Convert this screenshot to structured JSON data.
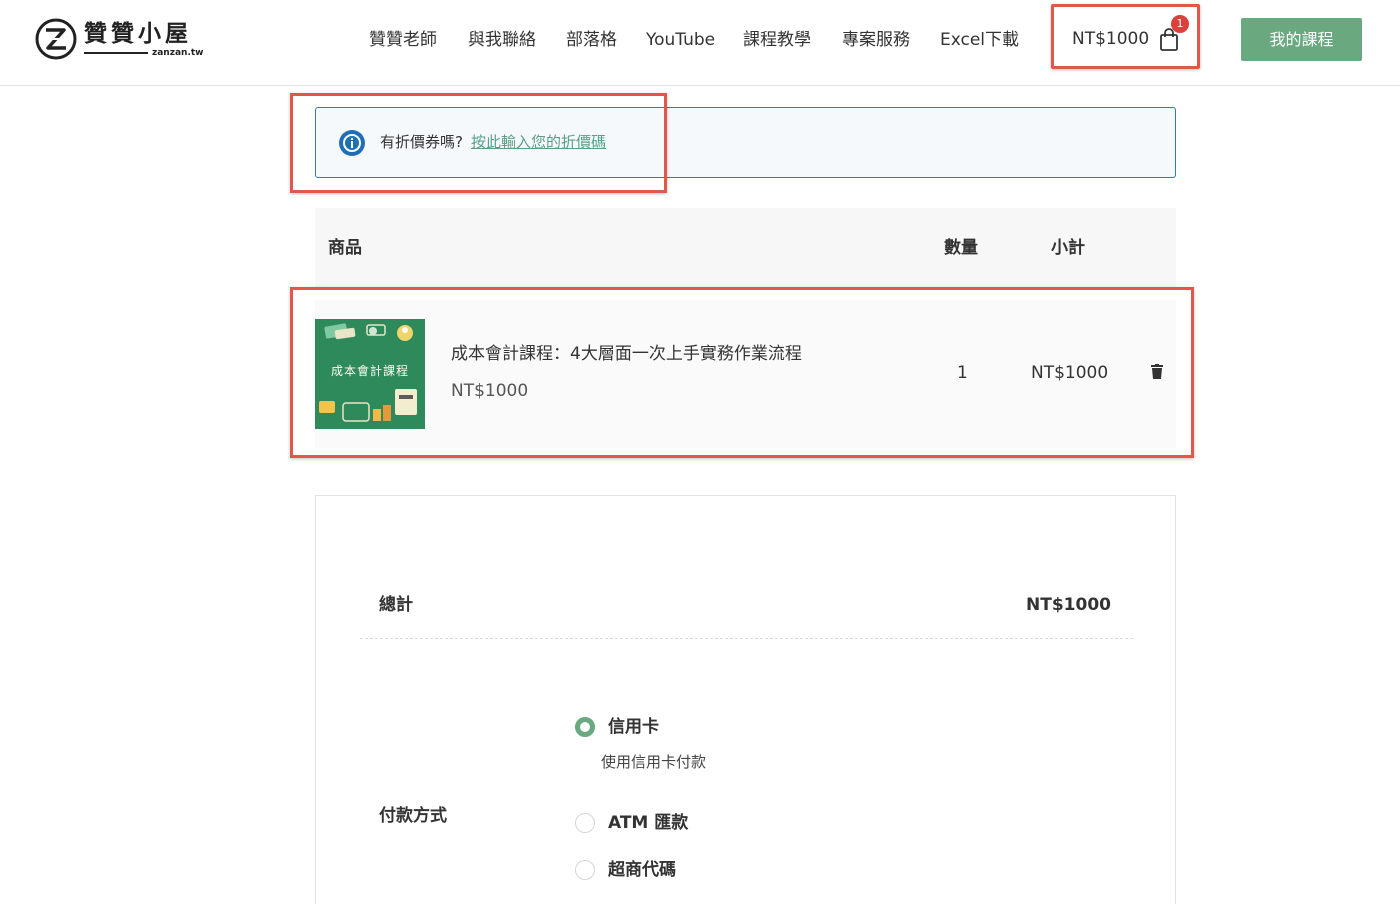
{
  "header": {
    "logo_title": "贊贊小屋",
    "logo_sub": "zanzan.tw",
    "nav": [
      "贊贊老師",
      "與我聯絡",
      "部落格",
      "YouTube",
      "課程教學",
      "專案服務",
      "Excel下載"
    ],
    "cart_amount": "NT$1000",
    "cart_count": "1",
    "my_courses_label": "我的課程"
  },
  "coupon": {
    "prompt": "有折價券嗎?",
    "link": "按此輸入您的折價碼"
  },
  "table": {
    "headers": {
      "product": "商品",
      "quantity": "數量",
      "subtotal": "小計"
    }
  },
  "cart_item": {
    "thumb_title": "成本會計課程",
    "name": "成本會計課程：4大層面一次上手實務作業流程",
    "price": "NT$1000",
    "quantity": "1",
    "subtotal": "NT$1000"
  },
  "summary": {
    "total_label": "總計",
    "total_value": "NT$1000",
    "payment_label": "付款方式",
    "payment_options": [
      {
        "label": "信用卡",
        "desc": "使用信用卡付款",
        "selected": true
      },
      {
        "label": "ATM 匯款",
        "selected": false
      },
      {
        "label": "超商代碼",
        "selected": false
      }
    ]
  },
  "colors": {
    "accent_green": "#6aa87f",
    "highlight_red": "#e2574c",
    "info_blue": "#1e6fb5",
    "link_green": "#5a9e85"
  }
}
